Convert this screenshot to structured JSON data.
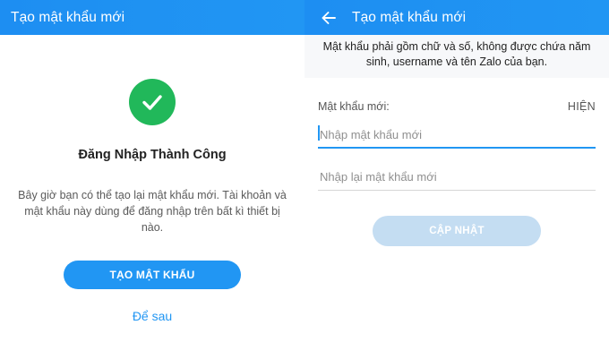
{
  "left": {
    "header_title": "Tạo mật khẩu mới",
    "success_title": "Đăng Nhập Thành Công",
    "success_desc": "Bây giờ bạn có thể tạo lại mật khẩu mới. Tài khoản và mật khẩu này dùng để đăng nhập trên bất kì thiết bị nào.",
    "create_button": "TẠO MẬT KHẨU",
    "later_link": "Để sau",
    "icon": "check-circle-icon",
    "success_color": "#21b85a"
  },
  "right": {
    "header_title": "Tạo mật khẩu mới",
    "back_icon": "arrow-left-icon",
    "note": "Mật khẩu phải gồm chữ và số, không được chứa năm sinh, username và tên Zalo của bạn.",
    "field_label": "Mật khẩu mới:",
    "show_toggle": "HIỆN",
    "new_password_placeholder": "Nhập mật khẩu mới",
    "confirm_password_placeholder": "Nhập lại mật khẩu mới",
    "update_button": "CẬP NHẬT"
  },
  "colors": {
    "accent": "#2196f3",
    "disabled_button": "#c4ddf2"
  }
}
